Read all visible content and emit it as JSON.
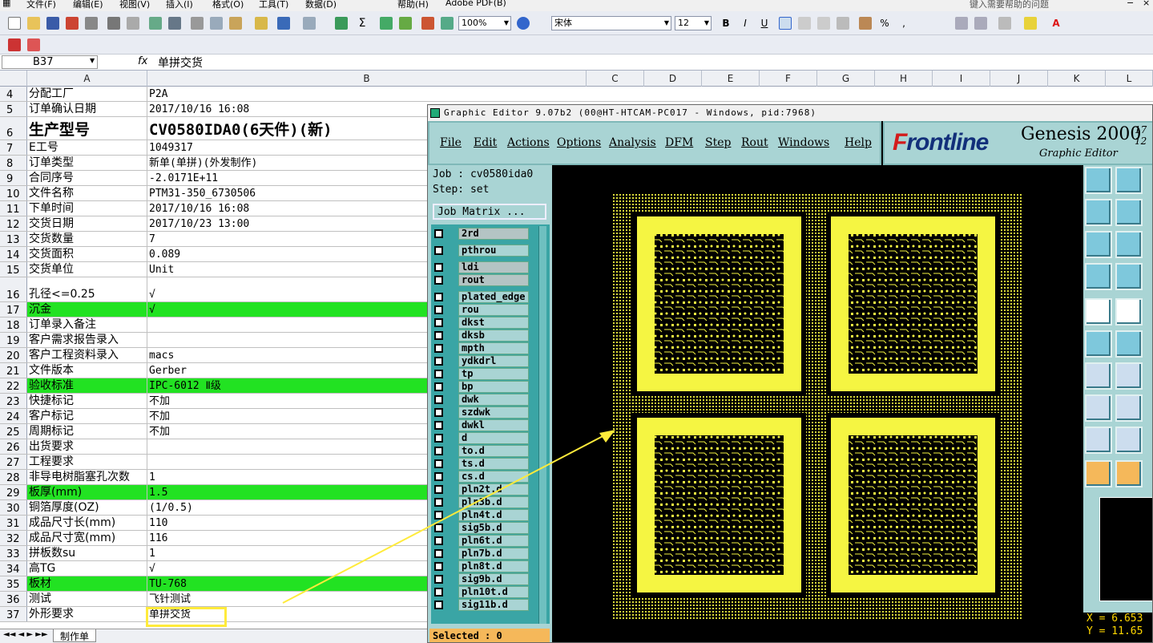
{
  "excel": {
    "menu": [
      "文件(F)",
      "编辑(E)",
      "视图(V)",
      "插入(I)",
      "格式(O)",
      "工具(T)",
      "数据(D)",
      "帮助(H)",
      "Adobe PDF(B)"
    ],
    "help_search_placeholder": "键入需要帮助的问题",
    "zoom": "100%",
    "font_name": "宋体",
    "font_size": "12",
    "name_box": "B37",
    "fx_label": "fx",
    "formula_value": "单拼交货",
    "columns": [
      "A",
      "B",
      "C",
      "D",
      "E",
      "F",
      "G",
      "H",
      "I",
      "J",
      "K",
      "L"
    ],
    "rows": [
      {
        "n": "4",
        "a": "分配工厂",
        "b": "P2A"
      },
      {
        "n": "5",
        "a": "订单确认日期",
        "b": "2017/10/16 16:08"
      },
      {
        "n": "6",
        "a": "生产型号",
        "b": "CV0580IDA0(6天件)(新)",
        "big": true
      },
      {
        "n": "7",
        "a": "E工号",
        "b": "1049317"
      },
      {
        "n": "8",
        "a": "订单类型",
        "b": "新单(单拼)(外发制作)"
      },
      {
        "n": "9",
        "a": "合同序号",
        "b": "-2.0171E+11"
      },
      {
        "n": "10",
        "a": "文件名称",
        "b": "PTM31-350_6730506"
      },
      {
        "n": "11",
        "a": "下单时间",
        "b": "2017/10/16 16:08"
      },
      {
        "n": "12",
        "a": "交货日期",
        "b": "2017/10/23 13:00"
      },
      {
        "n": "13",
        "a": "交货数量",
        "b": "7"
      },
      {
        "n": "14",
        "a": "交货面积",
        "b": "0.089"
      },
      {
        "n": "15",
        "a": "交货单位",
        "b": "Unit"
      },
      {
        "n": "16",
        "a": "孔径<=0.25",
        "b": "√",
        "tall": true
      },
      {
        "n": "17",
        "a": "沉金",
        "b": "√",
        "green": true
      },
      {
        "n": "18",
        "a": "订单录入备注",
        "b": ""
      },
      {
        "n": "19",
        "a": "客户需求报告录入",
        "b": ""
      },
      {
        "n": "20",
        "a": "客户工程资料录入",
        "b": "macs"
      },
      {
        "n": "21",
        "a": "文件版本",
        "b": "Gerber"
      },
      {
        "n": "22",
        "a": "验收标准",
        "b": "IPC-6012 Ⅱ级",
        "green": true
      },
      {
        "n": "23",
        "a": "快捷标记",
        "b": "不加"
      },
      {
        "n": "24",
        "a": "客户标记",
        "b": "不加"
      },
      {
        "n": "25",
        "a": "周期标记",
        "b": "不加"
      },
      {
        "n": "26",
        "a": "出货要求",
        "b": ""
      },
      {
        "n": "27",
        "a": "工程要求",
        "b": ""
      },
      {
        "n": "28",
        "a": "非导电树脂塞孔次数",
        "b": "1"
      },
      {
        "n": "29",
        "a": "板厚(mm)",
        "b": "1.5",
        "green": true
      },
      {
        "n": "30",
        "a": "铜箔厚度(OZ)",
        "b": "(1/0.5)"
      },
      {
        "n": "31",
        "a": "成品尺寸长(mm)",
        "b": "110"
      },
      {
        "n": "32",
        "a": "成品尺寸宽(mm)",
        "b": "116"
      },
      {
        "n": "33",
        "a": "拼板数su",
        "b": "1"
      },
      {
        "n": "34",
        "a": "高TG",
        "b": "√"
      },
      {
        "n": "35",
        "a": "板材",
        "b": "TU-768",
        "green": true
      },
      {
        "n": "36",
        "a": "测试",
        "b": "飞针测试"
      },
      {
        "n": "37",
        "a": "外形要求",
        "b": "单拼交货"
      }
    ],
    "sheet_tab": "制作单"
  },
  "genesis": {
    "title": "Graphic Editor 9.07b2 (00@HT-HTCAM-PC017 - Windows, pid:7968)",
    "menu": [
      "File",
      "Edit",
      "Actions",
      "Options",
      "Analysis",
      "DFM",
      "Step",
      "Rout",
      "Windows",
      "Help"
    ],
    "logo_front": "F",
    "logo_rest": "rontline",
    "product": "Genesis 2000",
    "product_sub": "Graphic Editor",
    "version": "17 12",
    "job": "Job : cv0580ida0",
    "step": "Step: set",
    "job_matrix": "Job Matrix ...",
    "layers": [
      "2rd",
      "pthrou",
      "ldi",
      "rout",
      "plated_edge",
      "rou",
      "dkst",
      "dksb",
      "mpth",
      "ydkdrl",
      "tp",
      "bp",
      "dwk",
      "szdwk",
      "dwkl",
      "d",
      "to.d",
      "ts.d",
      "cs.d",
      "pln2t.d",
      "pln3b.d",
      "pln4t.d",
      "sig5b.d",
      "pln6t.d",
      "pln7b.d",
      "pln8t.d",
      "sig9b.d",
      "pln10t.d",
      "sig11b.d"
    ],
    "selected": "Selected : 0",
    "x_readout": "X = 6.653",
    "y_readout": "Y = 11.65"
  },
  "colors": {
    "highlight_green": "#22e222",
    "genesis_panel": "#a9d4d4",
    "pcb_yellow": "#f5f542",
    "callout": "#ffeb3b"
  }
}
